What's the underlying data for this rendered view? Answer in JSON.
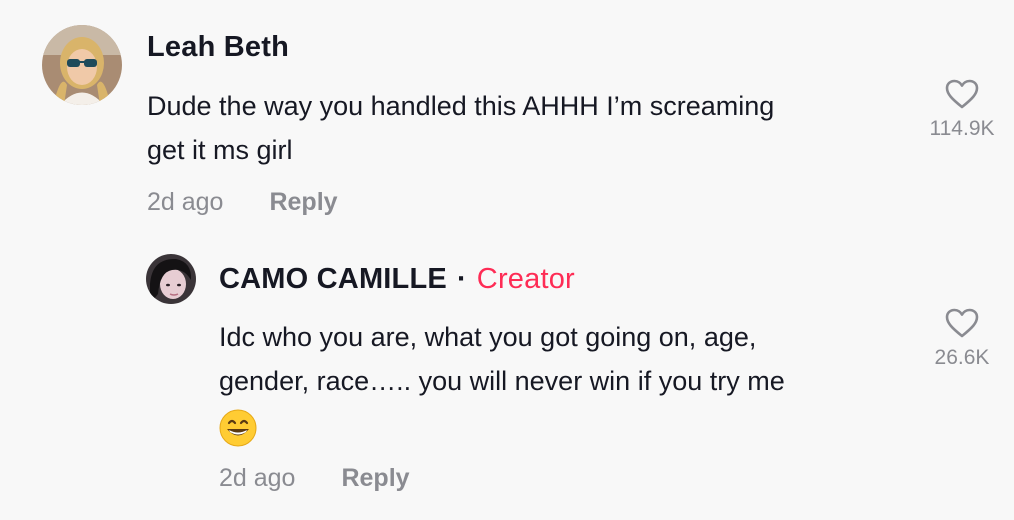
{
  "comments": [
    {
      "author": "Leah Beth",
      "text_line1": "Dude the way you handled this AHHH I’m screaming",
      "text_line2": "get it ms girl",
      "time": "2d ago",
      "reply_label": "Reply",
      "likes": "114.9K",
      "avatar_icon": "user-avatar-sunglasses"
    }
  ],
  "replies": [
    {
      "author": "CAMO CAMILLE",
      "separator": "·",
      "badge": "Creator",
      "text_line1": "Idc who you are, what you got going on, age,",
      "text_line2": "gender, race….. you will never win if you try me",
      "emoji": "grinning-face-emoji",
      "time": "2d ago",
      "reply_label": "Reply",
      "likes": "26.6K",
      "avatar_icon": "user-avatar-dark-hair"
    }
  ],
  "colors": {
    "background": "#f8f8f8",
    "creator_badge": "#fe2c55",
    "meta_gray": "#8a8b91",
    "text": "#161823"
  }
}
